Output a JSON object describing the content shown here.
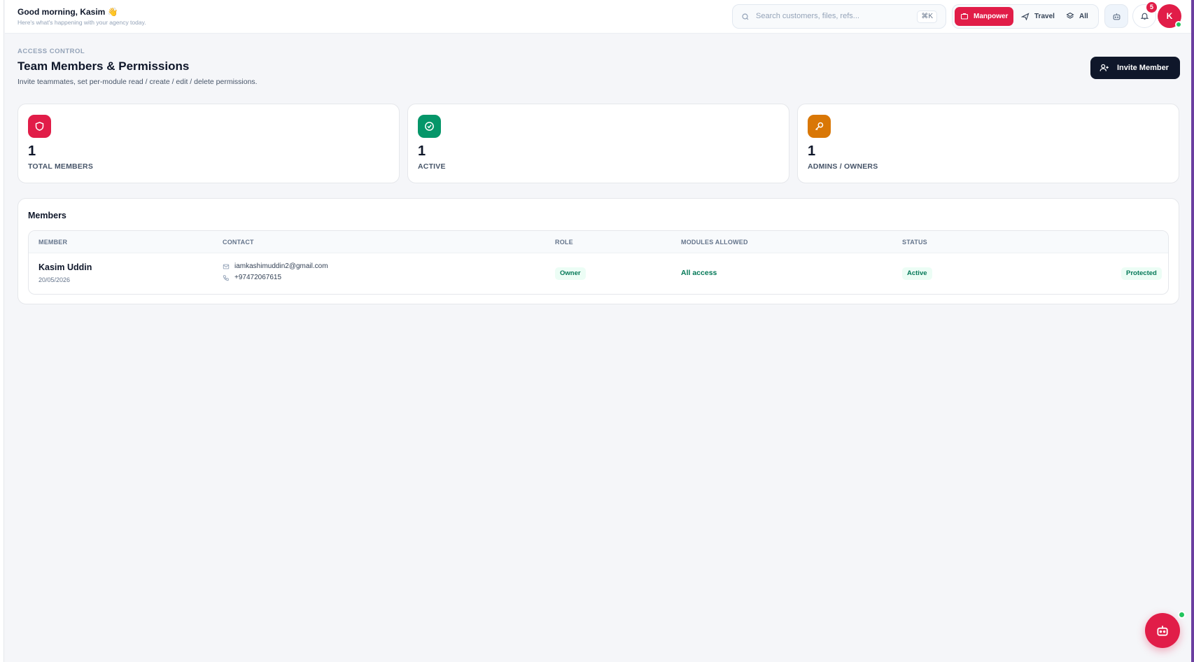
{
  "topbar": {
    "greeting": "Good morning, Kasim 👋",
    "greeting_sub": "Here's what's happening with your agency today.",
    "search_placeholder": "Search customers, files, refs...",
    "search_shortcut": "⌘K",
    "modes": [
      {
        "label": "Manpower",
        "icon": "briefcase-icon",
        "active": true
      },
      {
        "label": "Travel",
        "icon": "plane-icon",
        "active": false
      },
      {
        "label": "All",
        "icon": "layers-icon",
        "active": false
      }
    ],
    "notification_count": "5",
    "avatar_initial": "K"
  },
  "header": {
    "eyebrow": "ACCESS CONTROL",
    "title": "Team Members & Permissions",
    "subtitle": "Invite teammates, set per-module read / create / edit / delete permissions.",
    "invite_label": "Invite Member"
  },
  "stats": [
    {
      "value": "1",
      "label": "TOTAL MEMBERS",
      "icon": "shield-icon",
      "color": "#e11d48"
    },
    {
      "value": "1",
      "label": "ACTIVE",
      "icon": "check-circle-icon",
      "color": "#059669"
    },
    {
      "value": "1",
      "label": "ADMINS / OWNERS",
      "icon": "key-icon",
      "color": "#d97706"
    }
  ],
  "members": {
    "title": "Members",
    "columns": [
      "MEMBER",
      "CONTACT",
      "ROLE",
      "MODULES ALLOWED",
      "STATUS"
    ],
    "rows": [
      {
        "name": "Kasim Uddin",
        "date": "20/05/2026",
        "email": "iamkashimuddin2@gmail.com",
        "phone": "+97472067615",
        "role": "Owner",
        "modules": "All access",
        "status": "Active",
        "action": "Protected"
      }
    ]
  },
  "colors": {
    "brand": "#e11d48",
    "dark": "#0f172a",
    "success": "#047857"
  }
}
